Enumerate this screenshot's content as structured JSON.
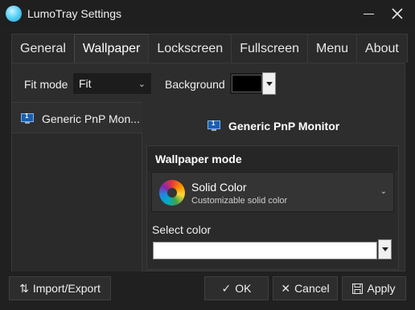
{
  "window": {
    "title": "LumoTray Settings"
  },
  "tabs": [
    {
      "label": "General",
      "active": false
    },
    {
      "label": "Wallpaper",
      "active": true
    },
    {
      "label": "Lockscreen",
      "active": false
    },
    {
      "label": "Fullscreen",
      "active": false
    },
    {
      "label": "Menu",
      "active": false
    },
    {
      "label": "About",
      "active": false
    }
  ],
  "wallpaper": {
    "fit_mode_label": "Fit mode",
    "fit_mode_value": "Fit",
    "background_label": "Background",
    "background_color": "#000000",
    "monitor_list": [
      {
        "label": "Generic PnP Mon...",
        "number": "1"
      }
    ],
    "selected_monitor": {
      "name": "Generic PnP Monitor",
      "number": "1"
    },
    "mode_header": "Wallpaper mode",
    "mode": {
      "name": "Solid Color",
      "description": "Customizable solid color"
    },
    "select_color_label": "Select color",
    "selected_color": "#ffffff"
  },
  "footer": {
    "import_export": "Import/Export",
    "ok": "OK",
    "cancel": "Cancel",
    "apply": "Apply"
  },
  "icons": {
    "chevron": "⌄",
    "check": "✓",
    "cross": "✕",
    "swap": "⇅",
    "save": "floppy-disk"
  }
}
